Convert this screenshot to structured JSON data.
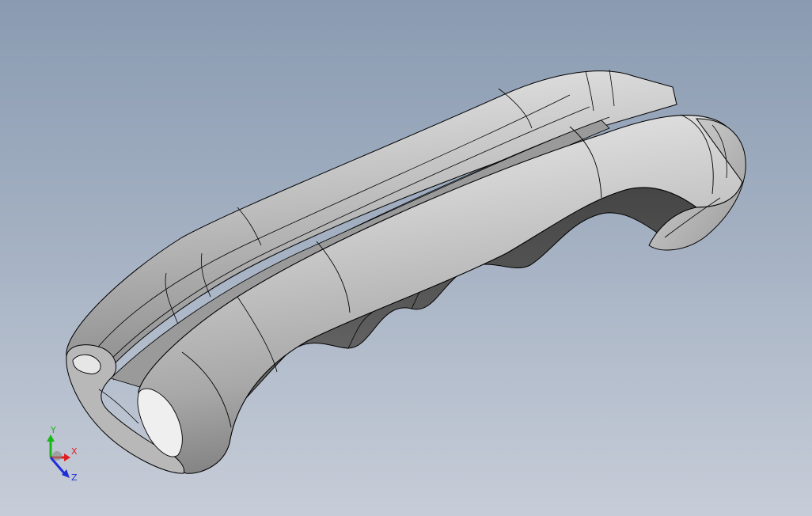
{
  "viewport": {
    "background_top": "#8a9bb1",
    "background_bottom": "#c7cdd8",
    "model": {
      "part": "handle-grip",
      "face_color": "#c8c8c8",
      "shade_color": "#5a5a5a",
      "edge_color": "#000000"
    },
    "triad": {
      "x_label": "X",
      "y_label": "Y",
      "z_label": "Z",
      "x_color": "#e02020",
      "y_color": "#18b818",
      "z_color": "#1e2fd8"
    }
  }
}
